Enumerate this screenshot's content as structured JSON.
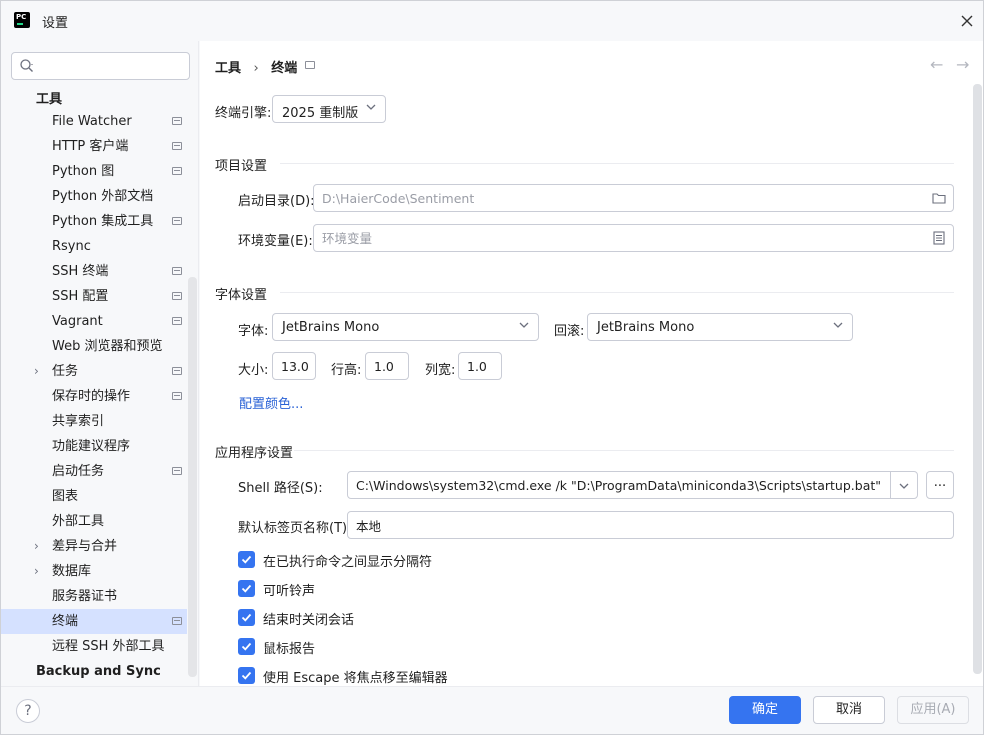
{
  "window": {
    "title": "设置"
  },
  "search": {
    "placeholder": "",
    "value": ""
  },
  "sidebar": {
    "items": [
      {
        "label": "工具",
        "type": "group"
      },
      {
        "label": "File Watcher",
        "mod": true
      },
      {
        "label": "HTTP 客户端",
        "mod": true
      },
      {
        "label": "Python 图",
        "mod": true
      },
      {
        "label": "Python 外部文档",
        "mod": false
      },
      {
        "label": "Python 集成工具",
        "mod": true
      },
      {
        "label": "Rsync",
        "mod": false
      },
      {
        "label": "SSH 终端",
        "mod": true
      },
      {
        "label": "SSH 配置",
        "mod": true
      },
      {
        "label": "Vagrant",
        "mod": true
      },
      {
        "label": "Web 浏览器和预览",
        "mod": false
      },
      {
        "label": "任务",
        "mod": true,
        "expandable": true
      },
      {
        "label": "保存时的操作",
        "mod": true
      },
      {
        "label": "共享索引",
        "mod": false
      },
      {
        "label": "功能建议程序",
        "mod": false
      },
      {
        "label": "启动任务",
        "mod": true
      },
      {
        "label": "图表",
        "mod": false
      },
      {
        "label": "外部工具",
        "mod": false
      },
      {
        "label": "差异与合并",
        "mod": false,
        "expandable": true
      },
      {
        "label": "数据库",
        "mod": false,
        "expandable": true
      },
      {
        "label": "服务器证书",
        "mod": false
      },
      {
        "label": "终端",
        "mod": true,
        "selected": true
      },
      {
        "label": "远程 SSH 外部工具",
        "mod": false
      },
      {
        "label": "Backup and Sync",
        "type": "group"
      }
    ]
  },
  "breadcrumb": {
    "parent": "工具",
    "sep": "›",
    "current": "终端"
  },
  "nav": {
    "back": "←",
    "forward": "→"
  },
  "engine": {
    "label": "终端引擎:",
    "value": "2025 重制版"
  },
  "project": {
    "title": "项目设置",
    "start_dir_label": "启动目录(D):",
    "start_dir_placeholder": "D:\\HaierCode\\Sentiment",
    "env_label": "环境变量(E):",
    "env_placeholder": "环境变量"
  },
  "font": {
    "title": "字体设置",
    "font_label": "字体:",
    "font_value": "JetBrains Mono",
    "fallback_label": "回滚:",
    "fallback_value": "JetBrains Mono",
    "size_label": "大小:",
    "size_value": "13.0",
    "line_label": "行高:",
    "line_value": "1.0",
    "col_label": "列宽:",
    "col_value": "1.0",
    "color_link": "配置颜色..."
  },
  "app": {
    "title": "应用程序设置",
    "shell_label": "Shell 路径(S):",
    "shell_value": "C:\\Windows\\system32\\cmd.exe /k \"D:\\ProgramData\\miniconda3\\Scripts\\startup.bat\"",
    "browse_label": "...",
    "tab_label": "默认标签页名称(T):",
    "tab_value": "本地",
    "checkboxes": [
      {
        "label": "在已执行命令之间显示分隔符",
        "checked": true
      },
      {
        "label": "可听铃声",
        "checked": true
      },
      {
        "label": "结束时关闭会话",
        "checked": true
      },
      {
        "label": "鼠标报告",
        "checked": true
      },
      {
        "label": "使用 Escape 将焦点移至编辑器",
        "checked": true
      }
    ]
  },
  "footer": {
    "help": "?",
    "ok": "确定",
    "cancel": "取消",
    "apply": "应用(A)"
  },
  "colors": {
    "accent": "#3574f0",
    "selected": "#d5e1ff",
    "link": "#2a62d6"
  }
}
